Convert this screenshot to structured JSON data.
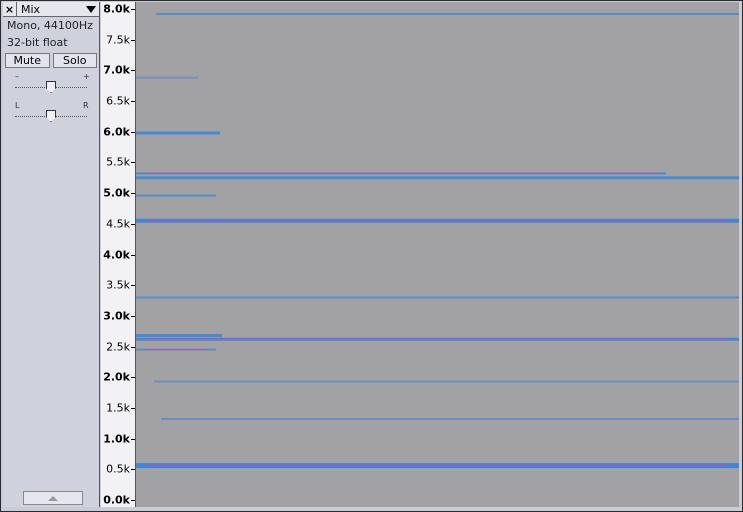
{
  "track": {
    "close_label": "×",
    "name": "Mix",
    "format": "Mono, 44100Hz",
    "bit_depth": "32-bit float",
    "mute_label": "Mute",
    "solo_label": "Solo",
    "gain_minus": "–",
    "gain_plus": "+",
    "pan_left": "L",
    "pan_right": "R",
    "gain_value": 0.5,
    "pan_value": 0.5
  },
  "ruler": {
    "labels": [
      "8.0k",
      "7.5k",
      "7.0k",
      "6.5k",
      "6.0k",
      "5.5k",
      "5.0k",
      "4.5k",
      "4.0k",
      "3.5k",
      "3.0k",
      "2.5k",
      "2.0k",
      "1.5k",
      "1.0k",
      "0.5k",
      "0.0k"
    ],
    "max_hz": 8000
  },
  "spectrogram": {
    "background": "#a2a2a4",
    "band_color": "#3f86d6",
    "peak_color": "#c84fb2",
    "bands_hz": [
      7920,
      6880,
      5980,
      5320,
      5250,
      4960,
      4550,
      3300,
      2680,
      2620,
      2450,
      1930,
      1320,
      560
    ]
  }
}
